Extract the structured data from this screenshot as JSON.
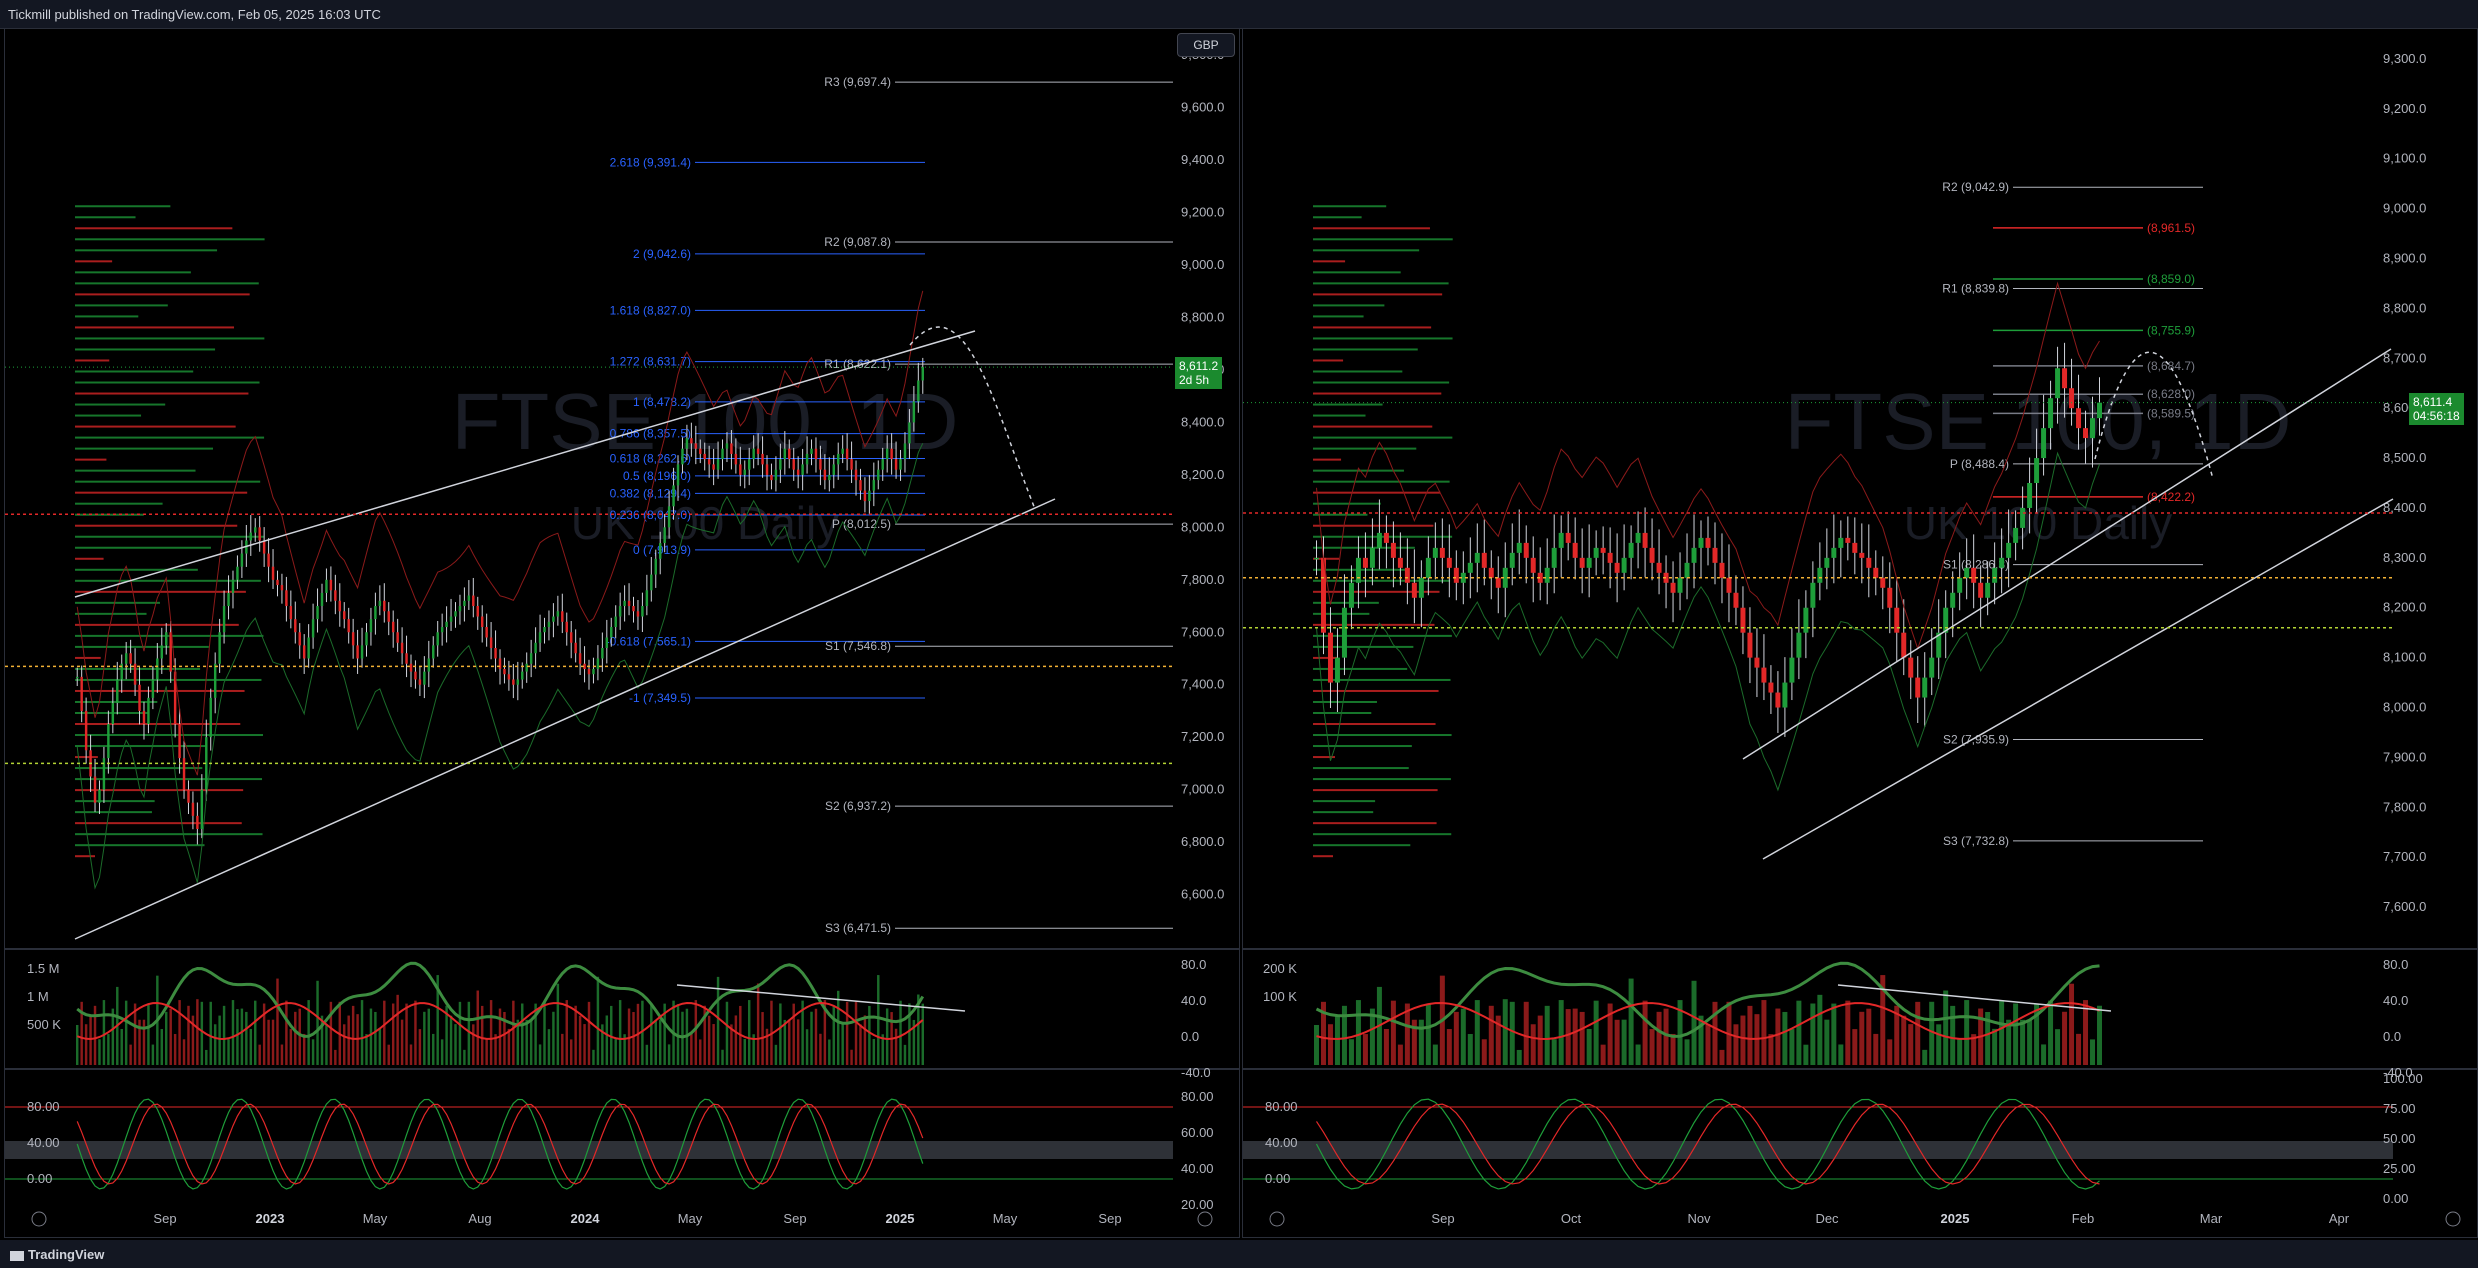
{
  "header": {
    "text": "Tickmill published on TradingView.com, Feb 05, 2025 16:03 UTC"
  },
  "footer": {
    "logo": "TradingView"
  },
  "colors": {
    "up": "#1e9e3a",
    "down": "#e32828",
    "blue": "#2962ff",
    "grid": "#131722"
  },
  "chart_data": [
    {
      "type": "candlestick",
      "watermark_title": "FTSE 100, 1D",
      "watermark_subtitle": "UK 100 Daily",
      "currency": "GBP",
      "last_price": "8,611.2",
      "countdown": "2d 5h",
      "ylim": [
        6400,
        9900
      ],
      "y_ticks": [
        "9,800.0",
        "9,600.0",
        "9,400.0",
        "9,200.0",
        "9,000.0",
        "8,800.0",
        "8,600.0",
        "8,400.0",
        "8,200.0",
        "8,000.0",
        "7,800.0",
        "7,600.0",
        "7,400.0",
        "7,200.0",
        "7,000.0",
        "6,800.0",
        "6,600.0"
      ],
      "x_ticks": [
        "Sep",
        "2023",
        "May",
        "Aug",
        "2024",
        "May",
        "Sep",
        "2025",
        "May",
        "Sep"
      ],
      "fib_levels": [
        {
          "label": "2.618 (9,391.4)",
          "value": 9391.4
        },
        {
          "label": "2 (9,042.6)",
          "value": 9042.6
        },
        {
          "label": "1.618 (8,827.0)",
          "value": 8827.0
        },
        {
          "label": "1.272 (8,631.7)",
          "value": 8631.7
        },
        {
          "label": "1 (8,478.2)",
          "value": 8478.2
        },
        {
          "label": "0.786 (8,357.5)",
          "value": 8357.5
        },
        {
          "label": "0.618 (8,262.6)",
          "value": 8262.6
        },
        {
          "label": "0.5 (8,196.0)",
          "value": 8196.0
        },
        {
          "label": "0.382 (8,129.4)",
          "value": 8129.4
        },
        {
          "label": "0.236 (8,047.0)",
          "value": 8047.0
        },
        {
          "label": "0 (7,913.9)",
          "value": 7913.9
        },
        {
          "label": "-0.618 (7,565.1)",
          "value": 7565.1
        },
        {
          "label": "-1 (7,349.5)",
          "value": 7349.5
        }
      ],
      "pivots": [
        {
          "label": "R3 (9,697.4)",
          "value": 9697.4
        },
        {
          "label": "R2 (9,087.8)",
          "value": 9087.8
        },
        {
          "label": "R1 (8,622.1)",
          "value": 8622.1
        },
        {
          "label": "P (8,012.5)",
          "value": 8012.5
        },
        {
          "label": "S1 (7,546.8)",
          "value": 7546.8
        },
        {
          "label": "S2 (6,937.2)",
          "value": 6937.2
        },
        {
          "label": "S3 (6,471.5)",
          "value": 6471.5
        }
      ],
      "closes": [
        7430,
        7300,
        7150,
        7050,
        6950,
        7000,
        7120,
        7250,
        7330,
        7420,
        7480,
        7520,
        7480,
        7400,
        7300,
        7250,
        7350,
        7420,
        7500,
        7550,
        7600,
        7450,
        7250,
        7120,
        7000,
        6950,
        6900,
        6850,
        7000,
        7200,
        7350,
        7480,
        7600,
        7700,
        7750,
        7800,
        7850,
        7900,
        7950,
        7980,
        8000,
        7950,
        7900,
        7850,
        7800,
        7780,
        7760,
        7700,
        7650,
        7600,
        7550,
        7500,
        7580,
        7650,
        7700,
        7750,
        7800,
        7760,
        7720,
        7680,
        7650,
        7600,
        7550,
        7500,
        7550,
        7600,
        7650,
        7700,
        7720,
        7680,
        7640,
        7600,
        7560,
        7520,
        7480,
        7450,
        7420,
        7400,
        7450,
        7500,
        7550,
        7600,
        7620,
        7640,
        7660,
        7680,
        7700,
        7720,
        7740,
        7700,
        7660,
        7620,
        7580,
        7540,
        7500,
        7460,
        7440,
        7420,
        7400,
        7420,
        7450,
        7480,
        7520,
        7560,
        7600,
        7620,
        7640,
        7660,
        7680,
        7640,
        7600,
        7560,
        7520,
        7480,
        7460,
        7440,
        7460,
        7500,
        7540,
        7580,
        7620,
        7660,
        7700,
        7720,
        7700,
        7680,
        7660,
        7700,
        7760,
        7820,
        7880,
        7940,
        8000,
        8080,
        8160,
        8240,
        8300,
        8340,
        8320,
        8300,
        8280,
        8260,
        8240,
        8220,
        8260,
        8300,
        8320,
        8280,
        8240,
        8200,
        8220,
        8260,
        8300,
        8280,
        8240,
        8200,
        8180,
        8220,
        8260,
        8300,
        8260,
        8220,
        8200,
        8240,
        8280,
        8300,
        8260,
        8220,
        8180,
        8200,
        8240,
        8280,
        8300,
        8260,
        8220,
        8180,
        8140,
        8100,
        8140,
        8180,
        8220,
        8260,
        8300,
        8260,
        8220,
        8260,
        8320,
        8400,
        8480,
        8560,
        8611
      ],
      "volume_axis": [
        "1.5 M",
        "1 M",
        "500 K"
      ],
      "rsi_axis": [
        "80.0",
        "40.0",
        "0.0",
        "-40.0"
      ],
      "stoch_axis_left": [
        "80.00",
        "40.00",
        "0.00"
      ],
      "stoch_axis_right": [
        "80.00",
        "60.00",
        "40.00",
        "20.00"
      ]
    },
    {
      "type": "candlestick",
      "watermark_title": "FTSE 100, 1D",
      "watermark_subtitle": "UK 100 Daily",
      "last_price": "8,611.4",
      "countdown": "04:56:18",
      "ylim": [
        7520,
        9360
      ],
      "y_ticks": [
        "9,300.0",
        "9,200.0",
        "9,100.0",
        "9,000.0",
        "8,900.0",
        "8,800.0",
        "8,700.0",
        "8,600.0",
        "8,500.0",
        "8,400.0",
        "8,300.0",
        "8,200.0",
        "8,100.0",
        "8,000.0",
        "7,900.0",
        "7,800.0",
        "7,700.0",
        "7,600.0"
      ],
      "x_ticks": [
        "Sep",
        "Oct",
        "Nov",
        "Dec",
        "2025",
        "Feb",
        "Mar",
        "Apr"
      ],
      "pivots": [
        {
          "label": "R2 (9,042.9)",
          "value": 9042.9
        },
        {
          "label": "R1 (8,839.8)",
          "value": 8839.8
        },
        {
          "label": "P (8,488.4)",
          "value": 8488.4
        },
        {
          "label": "S1 (8,286.3)",
          "value": 8286.3
        },
        {
          "label": "S2 (7,935.9)",
          "value": 7935.9
        },
        {
          "label": "S3 (7,732.8)",
          "value": 7732.8
        }
      ],
      "levels": [
        {
          "label": "(8,961.5)",
          "value": 8961.5,
          "color": "#e32828"
        },
        {
          "label": "(8,859.0)",
          "value": 8859.0,
          "color": "#1e9e3a"
        },
        {
          "label": "(8,755.9)",
          "value": 8755.9,
          "color": "#1e9e3a"
        },
        {
          "label": "(8,684.7)",
          "value": 8684.7,
          "color": "#787b86"
        },
        {
          "label": "(8,628.0)",
          "value": 8628.0,
          "color": "#787b86"
        },
        {
          "label": "(8,589.5)",
          "value": 8589.5,
          "color": "#787b86"
        },
        {
          "label": "(8,422.2)",
          "value": 8422.2,
          "color": "#e32828"
        }
      ],
      "closes": [
        8300,
        8150,
        8050,
        8100,
        8200,
        8250,
        8300,
        8280,
        8320,
        8350,
        8330,
        8300,
        8280,
        8250,
        8220,
        8260,
        8300,
        8320,
        8300,
        8280,
        8250,
        8270,
        8290,
        8310,
        8280,
        8260,
        8240,
        8280,
        8310,
        8330,
        8300,
        8270,
        8250,
        8280,
        8320,
        8350,
        8330,
        8300,
        8280,
        8300,
        8320,
        8310,
        8290,
        8270,
        8300,
        8330,
        8350,
        8320,
        8290,
        8270,
        8250,
        8230,
        8260,
        8290,
        8320,
        8340,
        8320,
        8290,
        8260,
        8230,
        8200,
        8150,
        8100,
        8080,
        8050,
        8030,
        8000,
        8050,
        8100,
        8150,
        8200,
        8250,
        8280,
        8300,
        8320,
        8340,
        8330,
        8310,
        8300,
        8280,
        8260,
        8240,
        8200,
        8150,
        8100,
        8060,
        8020,
        8060,
        8100,
        8150,
        8200,
        8230,
        8260,
        8280,
        8250,
        8220,
        8250,
        8280,
        8300,
        8330,
        8360,
        8400,
        8450,
        8500,
        8560,
        8620,
        8680,
        8640,
        8600,
        8560,
        8540,
        8580,
        8611
      ],
      "volume_axis": [
        "200 K",
        "100 K"
      ],
      "rsi_axis": [
        "80.0",
        "40.0",
        "0.0",
        "-40.0"
      ],
      "stoch_axis_left": [
        "80.00",
        "40.00",
        "0.00"
      ],
      "stoch_axis_right": [
        "100.00",
        "75.00",
        "50.00",
        "25.00",
        "0.00"
      ]
    }
  ]
}
